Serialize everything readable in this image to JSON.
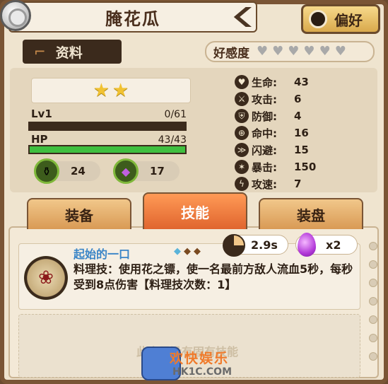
{
  "header": {
    "title": "腌花瓜",
    "favorite_label": "偏好"
  },
  "subheader": {
    "info_tab_label": "资料",
    "affinity_label": "好感度",
    "affinity_hearts": 6,
    "affinity_filled": 0
  },
  "profile": {
    "stars": 2,
    "level_label": "Lv1",
    "exp_value": "0/61",
    "exp_fraction": 0,
    "hp_label": "HP",
    "hp_value": "43/43",
    "hp_fraction": 1.0,
    "resources": [
      {
        "icon": "potion-icon",
        "value": "24"
      },
      {
        "icon": "purple-gem-icon",
        "value": "17"
      }
    ]
  },
  "attributes": [
    {
      "icon": "heart-icon",
      "label": "生命:",
      "value": "43"
    },
    {
      "icon": "attack-icon",
      "label": "攻击:",
      "value": "6"
    },
    {
      "icon": "shield-icon",
      "label": "防御:",
      "value": "4"
    },
    {
      "icon": "target-icon",
      "label": "命中:",
      "value": "16"
    },
    {
      "icon": "dodge-icon",
      "label": "闪避:",
      "value": "15"
    },
    {
      "icon": "crit-icon",
      "label": "暴击:",
      "value": "150"
    },
    {
      "icon": "speed-icon",
      "label": "攻速:",
      "value": "7"
    }
  ],
  "tabs": [
    {
      "label": "装备",
      "active": false
    },
    {
      "label": "技能",
      "active": true
    },
    {
      "label": "装盘",
      "active": false
    }
  ],
  "skill": {
    "name": "起始的一口",
    "cooldown": "2.9s",
    "uses": "x2",
    "description": "料理技：使用花之镖，使一名最前方敌人流血5秒，每秒受到8点伤害【料理技次数：1】"
  },
  "empty_slot_text": "此食灵没有固有技能",
  "watermark": {
    "brand": "欢快娱乐",
    "site": "HK1C.COM"
  },
  "colors": {
    "hp_bar": "#3fbf3f",
    "active_tab": "#e0652e",
    "skill_name": "#3a85c7",
    "brand": "#f07a2a"
  }
}
